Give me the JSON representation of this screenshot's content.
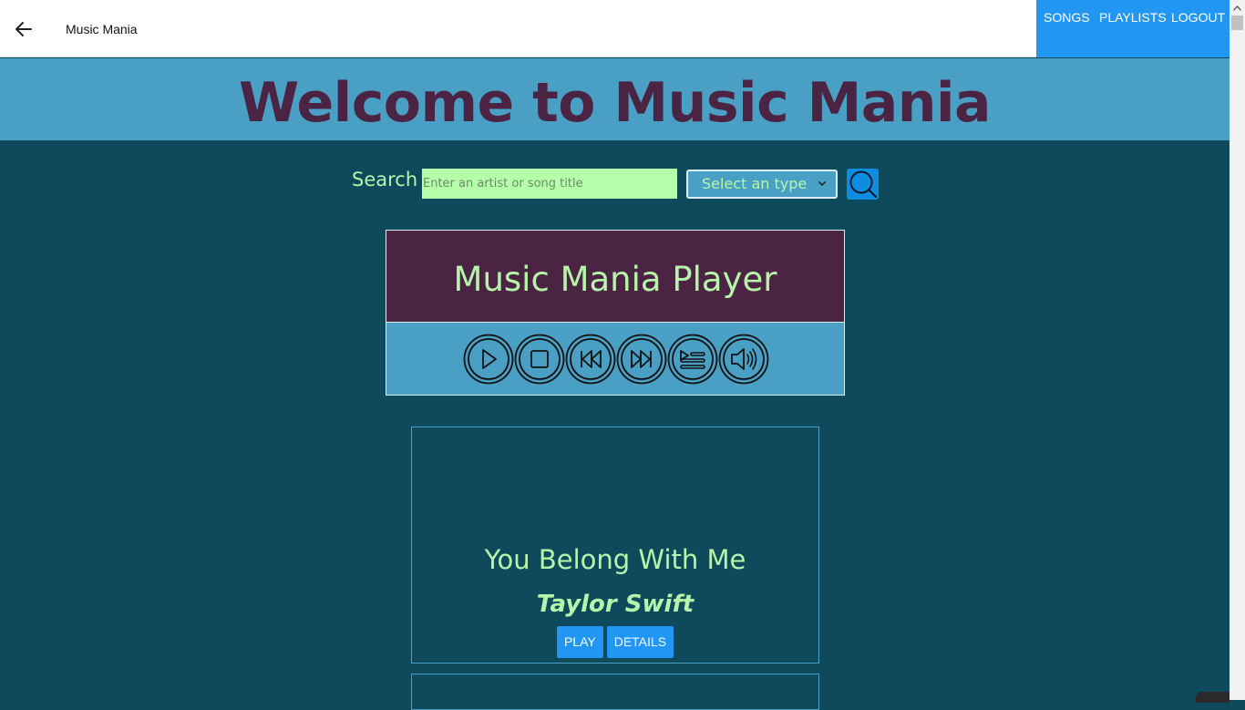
{
  "appbar": {
    "title": "Music Mania",
    "nav": [
      {
        "label": "SONGS"
      },
      {
        "label": "PLAYLISTS"
      },
      {
        "label": "LOGOUT"
      }
    ]
  },
  "hero": {
    "heading": "Welcome to Music Mania"
  },
  "search": {
    "label": "Search",
    "placeholder": "Enter an artist or song title",
    "value": "",
    "type_select": "Select an type"
  },
  "player": {
    "title": "Music Mania Player",
    "controls": [
      "play-icon",
      "stop-icon",
      "rewind-icon",
      "fast-forward-icon",
      "playlist-icon",
      "volume-icon"
    ]
  },
  "songs": [
    {
      "title": "You Belong With Me",
      "artist": "Taylor Swift",
      "play_label": "PLAY",
      "details_label": "DETAILS"
    }
  ],
  "colors": {
    "page_bg": "#0f4a5c",
    "hero_bg": "#4aa0c4",
    "accent_purple": "#4a2442",
    "text_green": "#b6f5a9",
    "nav_blue": "#2196f3"
  }
}
